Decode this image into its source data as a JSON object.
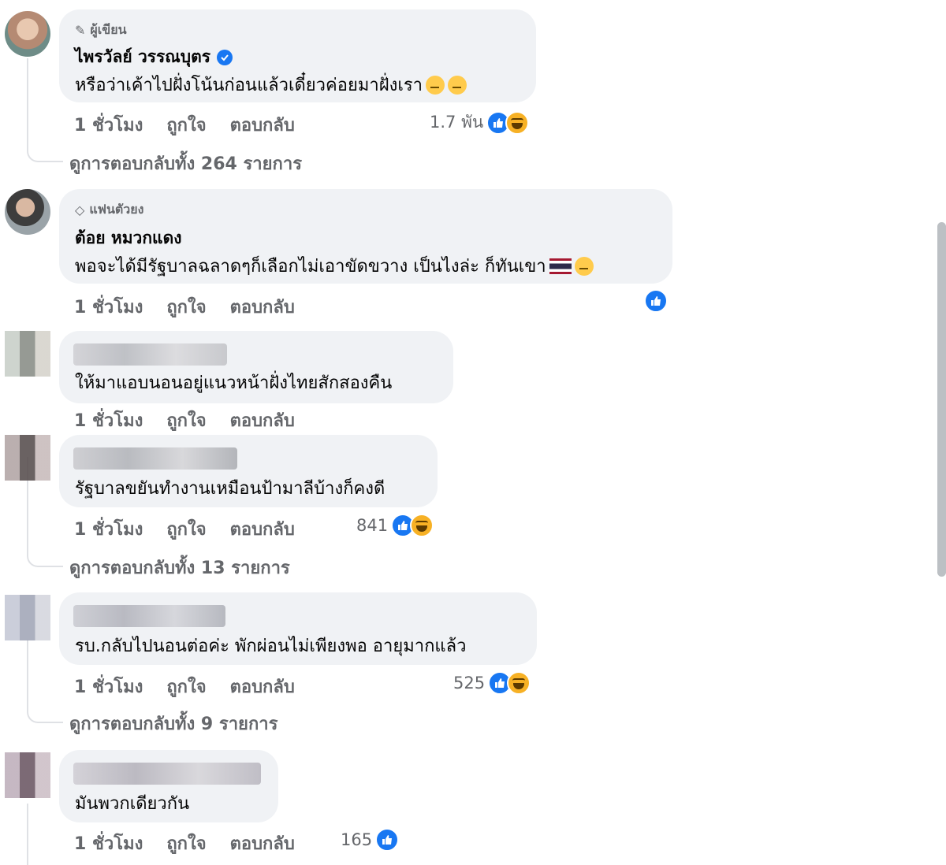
{
  "comments": [
    {
      "badge": "ผู้เขียน",
      "author": "ไพรวัลย์ วรรณบุตร",
      "text": "หรือว่าเค้าไปฝั่งโน้นก่อนแล้วเดี๋ยวค่อยมาฝั่งเรา",
      "time": "1 ชั่วโมง",
      "like_label": "ถูกใจ",
      "reply_label": "ตอบกลับ",
      "reaction_count": "1.7 พัน",
      "view_replies": "ดูการตอบกลับทั้ง 264 รายการ"
    },
    {
      "badge": "แฟนตัวยง",
      "author": "ต้อย หมวกแดง",
      "text": "พอจะได้มีรัฐบาลฉลาดๆก็เลือกไม่เอาขัดขวาง เป็นไงล่ะ ก็ทันเขา",
      "time": "1 ชั่วโมง",
      "like_label": "ถูกใจ",
      "reply_label": "ตอบกลับ"
    },
    {
      "text": "ให้มาแอบนอนอยู่แนวหน้าฝั่งไทยสักสองคืน",
      "time": "1 ชั่วโมง",
      "like_label": "ถูกใจ",
      "reply_label": "ตอบกลับ"
    },
    {
      "text": "รัฐบาลขยันทำงานเหมือนป้ามาลีบ้างก็คงดี",
      "time": "1 ชั่วโมง",
      "like_label": "ถูกใจ",
      "reply_label": "ตอบกลับ",
      "reaction_count": "841",
      "view_replies": "ดูการตอบกลับทั้ง 13 รายการ"
    },
    {
      "text": "รบ.กลับไปนอนต่อค่ะ พักผ่อนไม่เพียงพอ อายุมากแล้ว",
      "time": "1 ชั่วโมง",
      "like_label": "ถูกใจ",
      "reply_label": "ตอบกลับ",
      "reaction_count": "525",
      "view_replies": "ดูการตอบกลับทั้ง 9 รายการ"
    },
    {
      "text": "มันพวกเดียวกัน",
      "time": "1 ชั่วโมง",
      "like_label": "ถูกใจ",
      "reply_label": "ตอบกลับ",
      "reaction_count": "165"
    }
  ],
  "icons": {
    "badge_author": "pencil-icon",
    "badge_fan": "diamond-icon",
    "reaction_like": "like-reaction-icon",
    "reaction_haha": "haha-reaction-icon"
  },
  "colors": {
    "bubble": "#f0f2f5",
    "secondary_text": "#65676b",
    "like_blue": "#1877f2",
    "thread_line": "#dfe1e5"
  }
}
